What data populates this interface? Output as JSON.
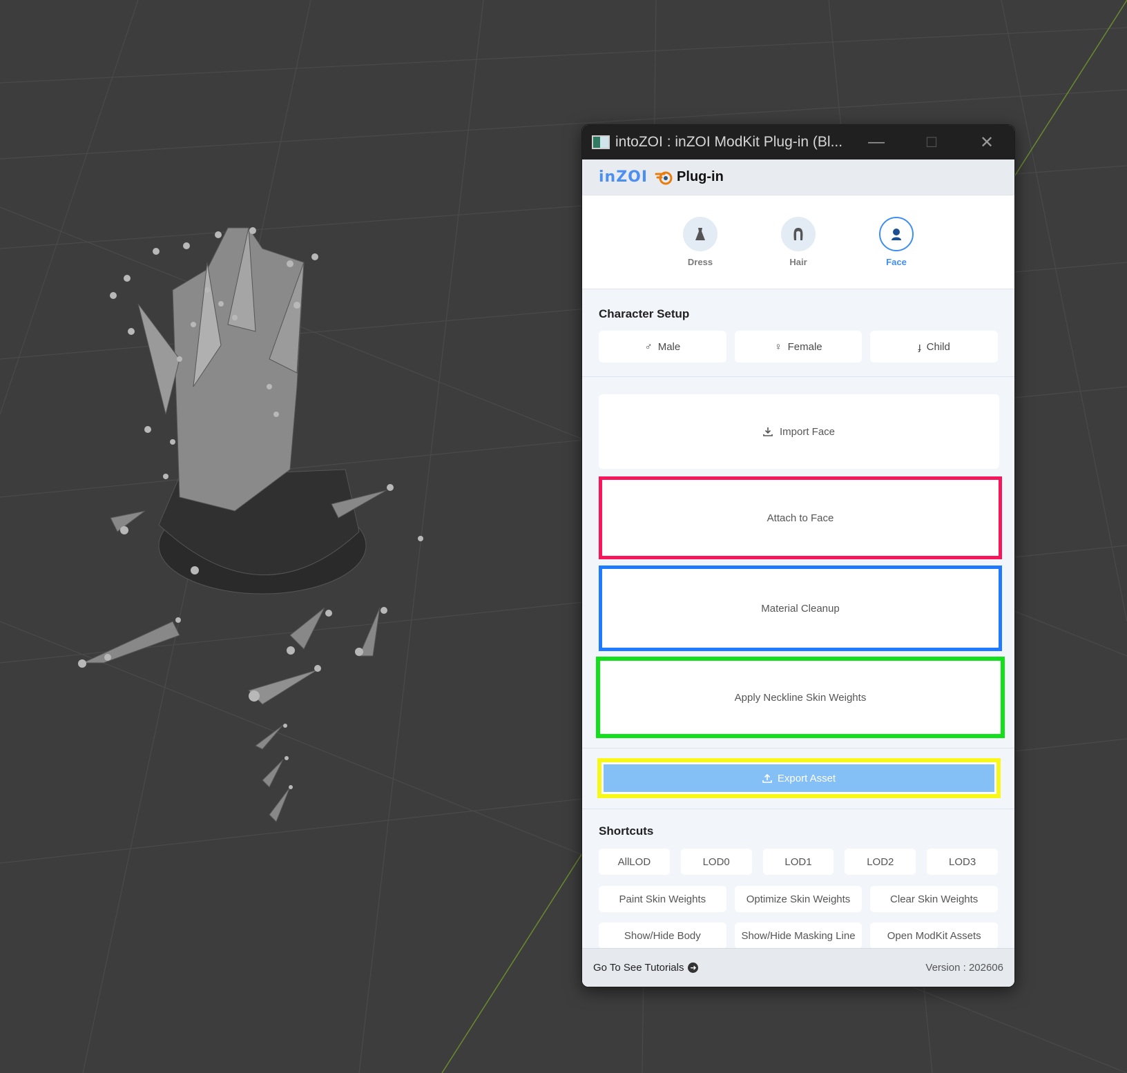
{
  "window": {
    "title": "intoZOI : inZOI ModKit Plug-in (Bl...",
    "minimize_glyph": "—",
    "maximize_glyph": "☐",
    "close_glyph": "✕"
  },
  "brand": {
    "logo_text": "inZOI",
    "title": "Plug-in",
    "icon": "blender-icon"
  },
  "tabs": [
    {
      "label": "Dress",
      "icon": "dress-icon",
      "active": false
    },
    {
      "label": "Hair",
      "icon": "hair-icon",
      "active": false
    },
    {
      "label": "Face",
      "icon": "face-icon",
      "active": true
    }
  ],
  "character_setup": {
    "title": "Character Setup",
    "buttons": [
      {
        "label": "Male",
        "glyph": "♂"
      },
      {
        "label": "Female",
        "glyph": "♀"
      },
      {
        "label": "Child",
        "glyph": "ɟ"
      }
    ]
  },
  "actions": {
    "import_face": "Import Face",
    "attach_to_face": "Attach to Face",
    "material_cleanup": "Material Cleanup",
    "apply_neckline": "Apply Neckline Skin Weights",
    "export_asset": "Export Asset"
  },
  "highlight_colors": {
    "attach": "#f5175a",
    "material": "#1f7aff",
    "neckline": "#12e01a",
    "export": "#f7f719"
  },
  "shortcuts": {
    "title": "Shortcuts",
    "lod_buttons": [
      "AllLOD",
      "LOD0",
      "LOD1",
      "LOD2",
      "LOD3"
    ],
    "row2": [
      "Paint Skin Weights",
      "Optimize Skin Weights",
      "Clear Skin Weights"
    ],
    "row3": [
      "Show/Hide Body",
      "Show/Hide Masking Line",
      "Open ModKit Assets"
    ]
  },
  "footer": {
    "tutorial_link": "Go To See Tutorials",
    "version": "Version : 202606"
  }
}
